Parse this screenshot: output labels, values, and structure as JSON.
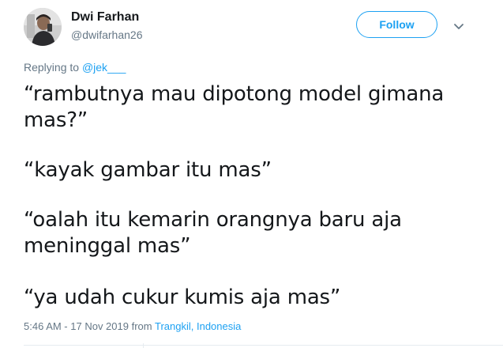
{
  "author": {
    "display_name": "Dwi Farhan",
    "handle": "@dwifarhan26"
  },
  "follow_button": {
    "label": "Follow"
  },
  "reply": {
    "prefix": "Replying to",
    "target": "@jek___"
  },
  "tweet": {
    "lines": [
      "“rambutnya mau dipotong model gimana mas?”",
      "“kayak gambar itu mas”",
      "“oalah itu kemarin orangnya baru aja meninggal mas”",
      "“ya udah cukur kumis aja mas”"
    ]
  },
  "meta": {
    "timestamp": "5:46 AM - 17 Nov 2019",
    "from_label": "from",
    "location": "Trangkil, Indonesia"
  },
  "icons": {
    "avatar": "user-avatar-photo",
    "more": "chevron-down-icon"
  },
  "colors": {
    "accent": "#1da1f2",
    "text": "#14171a",
    "secondary": "#657786"
  }
}
